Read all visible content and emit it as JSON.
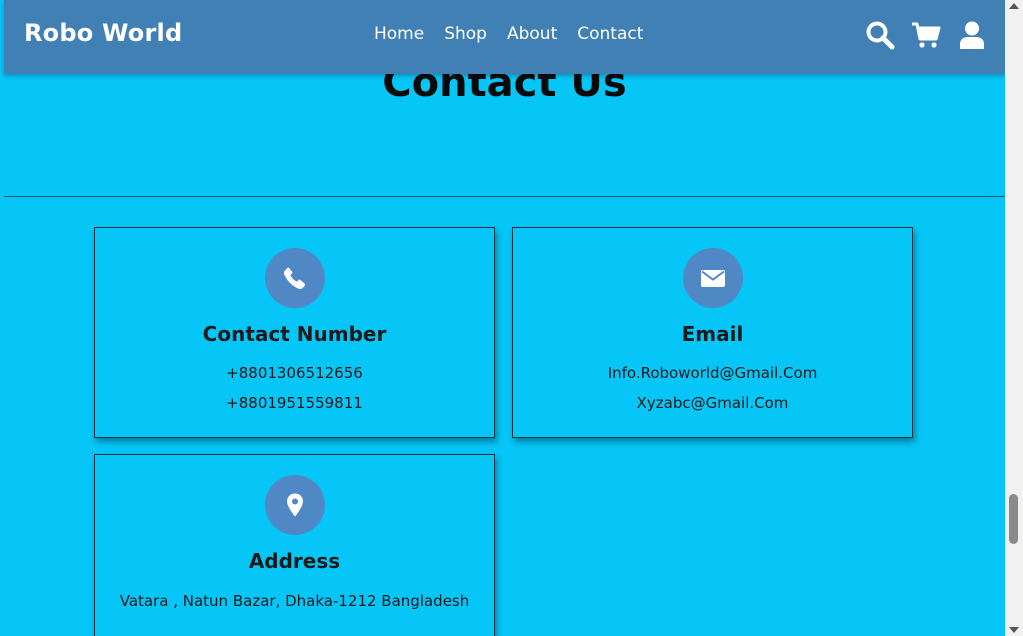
{
  "header": {
    "brand": "Robo World",
    "nav": [
      "Home",
      "Shop",
      "About",
      "Contact"
    ],
    "icons": [
      "search-icon",
      "cart-icon",
      "user-icon"
    ]
  },
  "page": {
    "title": "Contact Us"
  },
  "cards": [
    {
      "icon": "phone-icon",
      "title": "Contact Number",
      "lines": [
        "+8801306512656",
        "+8801951559811"
      ]
    },
    {
      "icon": "envelope-icon",
      "title": "Email",
      "lines": [
        "Info.Roboworld@Gmail.Com",
        "Xyzabc@Gmail.Com"
      ]
    },
    {
      "icon": "map-pin-icon",
      "title": "Address",
      "lines": [
        "Vatara , Natun Bazar, Dhaka-1212 Bangladesh"
      ]
    }
  ],
  "colors": {
    "page_background": "#06c5f7",
    "navbar": "#4180b5",
    "icon_circle": "#5088c6"
  }
}
